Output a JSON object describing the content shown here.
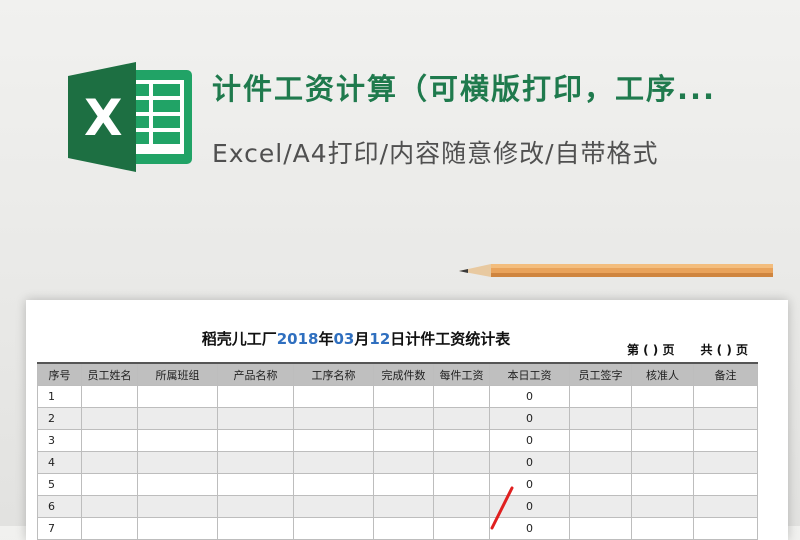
{
  "header": {
    "title": "计件工资计算（可横版打印，工序...",
    "subtitle": "Excel/A4打印/内容随意修改/自带格式"
  },
  "icons": {
    "logo": "excel-logo-icon",
    "pencil": "pencil-icon"
  },
  "colors": {
    "excel_green": "#1f7a4d",
    "date_blue": "#2f6fbf",
    "header_gray": "#bfbfbf",
    "red_mark": "#e02020"
  },
  "sheet": {
    "title_parts": {
      "prefix": "稻壳儿工厂",
      "year": "2018",
      "year_unit": "年",
      "month": "03",
      "month_unit": "月",
      "day": "12",
      "suffix": "日计件工资统计表"
    },
    "page_info": {
      "page": "第 ( ) 页",
      "total": "共 ( ) 页"
    },
    "columns": [
      "序号",
      "员工姓名",
      "所属班组",
      "产品名称",
      "工序名称",
      "完成件数",
      "每件工资",
      "本日工资",
      "员工签字",
      "核准人",
      "备注"
    ],
    "rows": [
      {
        "seq": "1",
        "daily_wage": "0"
      },
      {
        "seq": "2",
        "daily_wage": "0"
      },
      {
        "seq": "3",
        "daily_wage": "0"
      },
      {
        "seq": "4",
        "daily_wage": "0"
      },
      {
        "seq": "5",
        "daily_wage": "0"
      },
      {
        "seq": "6",
        "daily_wage": "0"
      },
      {
        "seq": "7",
        "daily_wage": "0"
      }
    ]
  }
}
